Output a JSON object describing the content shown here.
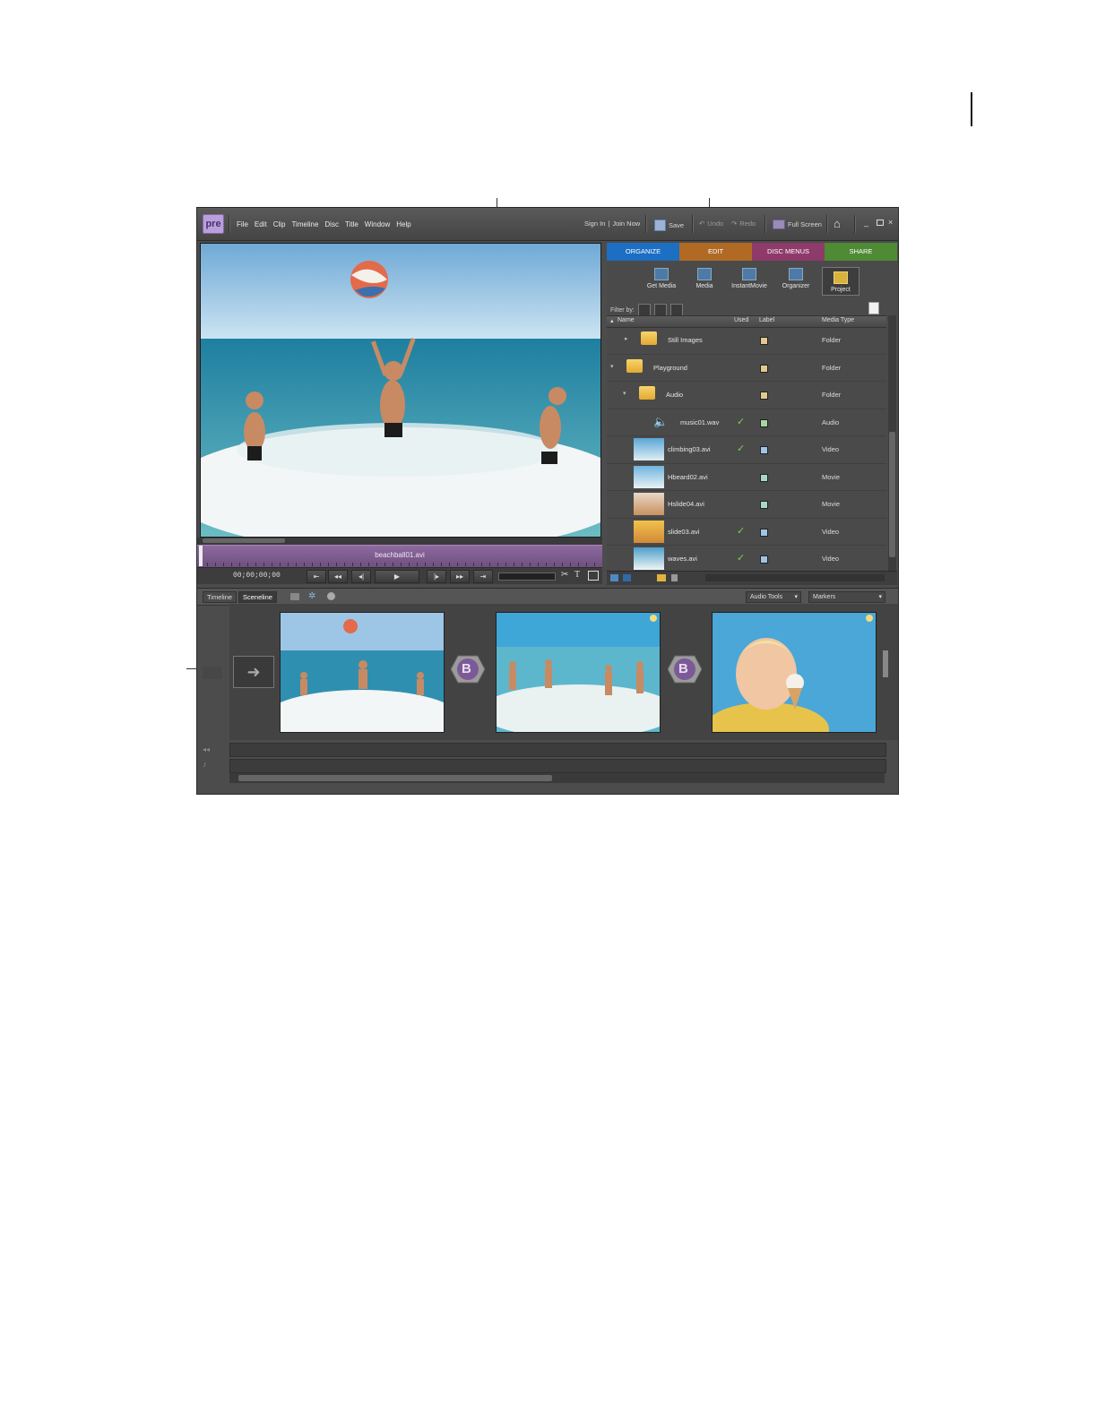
{
  "app": {
    "logo": "pre",
    "menu": [
      "File",
      "Edit",
      "Clip",
      "Timeline",
      "Disc",
      "Title",
      "Window",
      "Help"
    ],
    "sign_in": "Sign In",
    "join_now": "Join Now",
    "save": "Save",
    "undo": "Undo",
    "redo": "Redo",
    "full_screen": "Full Screen"
  },
  "monitor": {
    "clip_name": "beachball01.avi",
    "timecode": "00;00;00;00"
  },
  "tasks": {
    "tabs": [
      "ORGANIZE",
      "EDIT",
      "DISC MENUS",
      "SHARE"
    ],
    "tab_colors": [
      "#1c6fc2",
      "#b06a24",
      "#8e3a6a",
      "#4f8a34"
    ],
    "subtools": [
      "Get Media",
      "Media",
      "InstantMovie",
      "Organizer",
      "Project"
    ],
    "active_subtool": "Project",
    "filter_label": "Filter by:",
    "columns": [
      "Name",
      "Used",
      "Label",
      "Media Type"
    ],
    "items": [
      {
        "name": "Still Images",
        "used": "",
        "type": "Folder",
        "label_color": "#e2c98e"
      },
      {
        "name": "Playground",
        "used": "",
        "type": "Folder",
        "label_color": "#e2c98e"
      },
      {
        "name": "Audio",
        "used": "",
        "type": "Folder",
        "label_color": "#e2c98e"
      },
      {
        "name": "music01.wav",
        "used": "✓",
        "type": "Audio",
        "label_color": "#a8d6a0"
      },
      {
        "name": "climbing03.avi",
        "used": "✓",
        "type": "Video",
        "label_color": "#9fc4e6"
      },
      {
        "name": "Hbeard02.avi",
        "used": "",
        "type": "Movie",
        "label_color": "#a8d6c8"
      },
      {
        "name": "Hslide04.avi",
        "used": "",
        "type": "Movie",
        "label_color": "#a8d6c8"
      },
      {
        "name": "slide03.avi",
        "used": "✓",
        "type": "Video",
        "label_color": "#9fc4e6"
      },
      {
        "name": "waves.avi",
        "used": "✓",
        "type": "Video",
        "label_color": "#9fc4e6"
      }
    ]
  },
  "bottom": {
    "tabs": [
      "Timeline",
      "Sceneline"
    ],
    "active_tab": "Sceneline",
    "audio_tools": "Audio Tools",
    "markers": "Markers",
    "transition_letter": "B"
  }
}
